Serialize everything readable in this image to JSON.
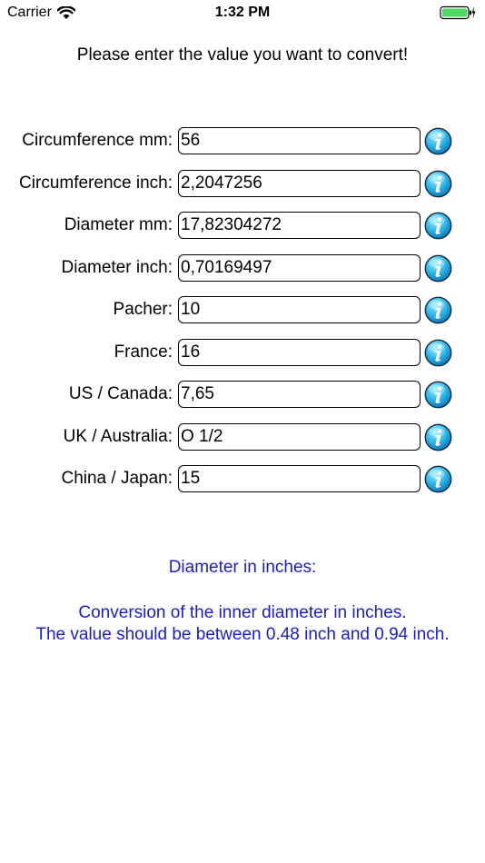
{
  "status_bar": {
    "carrier": "Carrier",
    "time": "1:32 PM",
    "battery_color": "#4cd964"
  },
  "prompt": "Please enter the value you want to convert!",
  "rows": [
    {
      "label": "Circumference mm:",
      "value": "56"
    },
    {
      "label": "Circumference inch:",
      "value": "2,2047256"
    },
    {
      "label": "Diameter mm:",
      "value": "17,82304272"
    },
    {
      "label": "Diameter inch:",
      "value": "0,70169497"
    },
    {
      "label": "Pacher:",
      "value": "10"
    },
    {
      "label": "France:",
      "value": "16"
    },
    {
      "label": "US / Canada:",
      "value": "7,65"
    },
    {
      "label": "UK / Australia:",
      "value": "O 1/2"
    },
    {
      "label": "China / Japan:",
      "value": "15"
    }
  ],
  "info_icon": "info-icon",
  "help": {
    "title": "Diameter in inches:",
    "line1": "Conversion of the inner diameter in inches.",
    "line2": "The value should be between 0.48 inch and 0.94 inch.",
    "color": "#1a1ad8"
  }
}
